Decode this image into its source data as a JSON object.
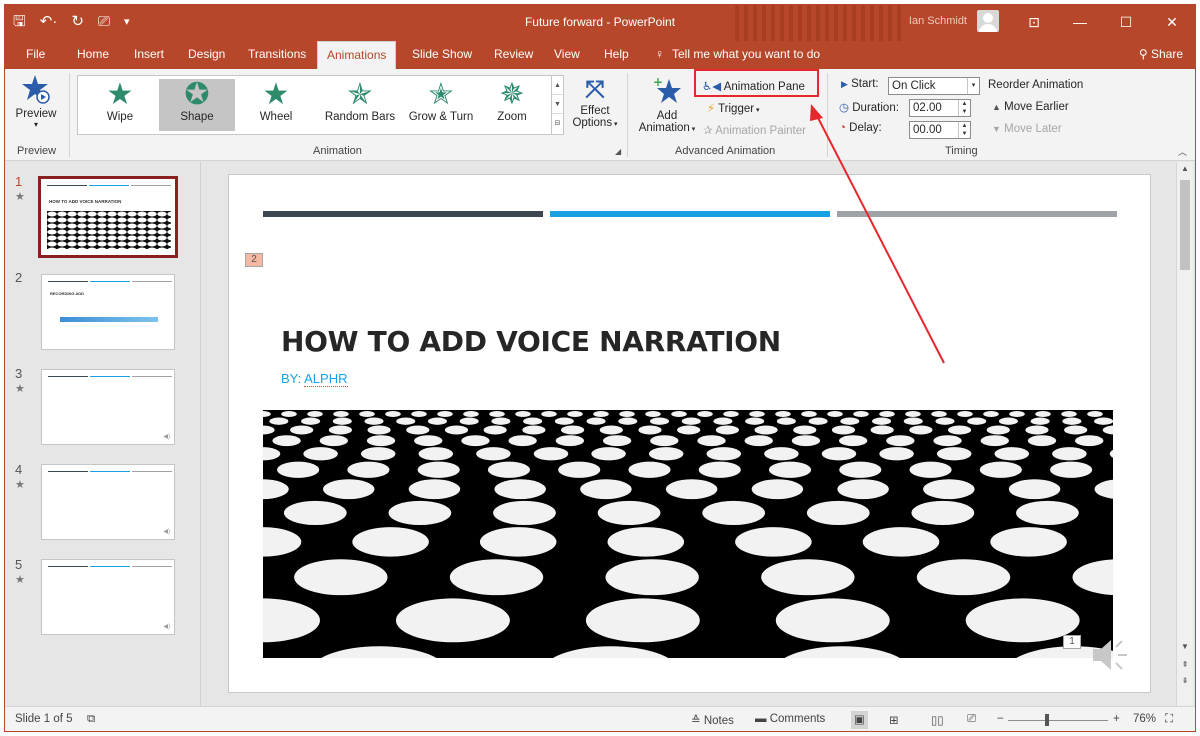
{
  "window": {
    "title": "Future forward - PowerPoint",
    "user_name": "Ian Schmidt",
    "controls": {
      "minimize": "—",
      "restore": "☐",
      "close": "✕",
      "ribbon_display": "⊡"
    }
  },
  "quick_access": {
    "save": "🖫",
    "undo": "↶·",
    "redo": "↻",
    "present": "⎚",
    "customize": "▾"
  },
  "tabs": [
    "File",
    "Home",
    "Insert",
    "Design",
    "Transitions",
    "Animations",
    "Slide Show",
    "Review",
    "View",
    "Help"
  ],
  "active_tab": "Animations",
  "tell_me": "Tell me what you want to do",
  "share": "Share",
  "ribbon": {
    "preview": {
      "label": "Preview",
      "group": "Preview"
    },
    "animation_group": "Animation",
    "animations": [
      {
        "label": "Wipe",
        "icon": "star-wipe-icon"
      },
      {
        "label": "Shape",
        "icon": "star-shape-icon"
      },
      {
        "label": "Wheel",
        "icon": "star-wheel-icon"
      },
      {
        "label": "Random Bars",
        "icon": "star-random-bars-icon"
      },
      {
        "label": "Grow & Turn",
        "icon": "star-grow-turn-icon"
      },
      {
        "label": "Zoom",
        "icon": "star-zoom-icon"
      }
    ],
    "selected_animation": "Shape",
    "effect_options": {
      "line1": "Effect",
      "line2": "Options"
    },
    "add_animation": {
      "line1": "Add",
      "line2": "Animation"
    },
    "advanced_group": "Advanced Animation",
    "animation_pane": "Animation Pane",
    "trigger": "Trigger",
    "animation_painter": "Animation Painter",
    "timing_group": "Timing",
    "start_label": "Start:",
    "start_value": "On Click",
    "duration_label": "Duration:",
    "duration_value": "02.00",
    "delay_label": "Delay:",
    "delay_value": "00.00",
    "reorder_title": "Reorder Animation",
    "move_earlier": "Move Earlier",
    "move_later": "Move Later"
  },
  "thumbnails": [
    {
      "number": "1",
      "star": "★",
      "title": "HOW TO ADD VOICE NARRATION"
    },
    {
      "number": "2",
      "star": "",
      "title": "RECORDING ADD"
    },
    {
      "number": "3",
      "star": "★",
      "title": ""
    },
    {
      "number": "4",
      "star": "★",
      "title": ""
    },
    {
      "number": "5",
      "star": "★",
      "title": ""
    }
  ],
  "slide": {
    "title": "HOW TO ADD VOICE NARRATION",
    "subtitle_prefix": "BY: ",
    "subtitle_name": "ALPHR",
    "animation_tag_title": "2",
    "animation_tag_audio": "1",
    "bar_colors": [
      "#3c4650",
      "#1ba1e2",
      "#9fa3a7"
    ]
  },
  "status_bar": {
    "slide_info": "Slide 1 of 5",
    "notes": "Notes",
    "comments": "Comments",
    "zoom": "76%",
    "zoom_minus": "−",
    "zoom_plus": "+"
  },
  "colors": {
    "accent": "#b7472a",
    "highlight": "#e8262d",
    "anim_star": "#2e8b6a"
  }
}
